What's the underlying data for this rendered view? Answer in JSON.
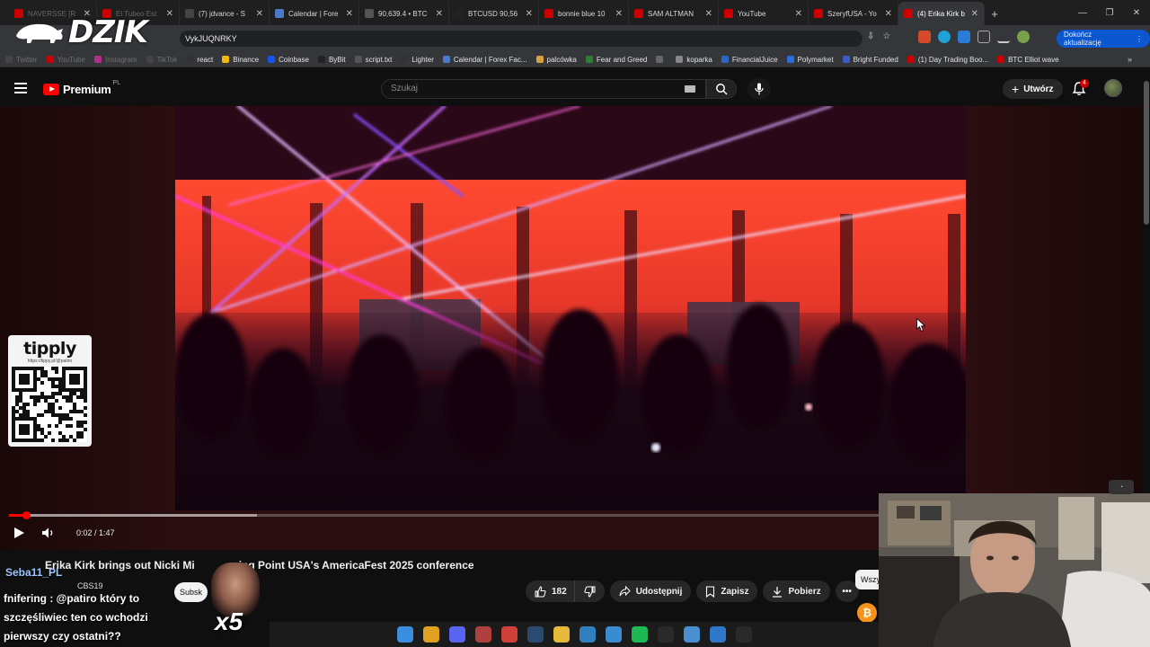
{
  "browser": {
    "tabs": [
      {
        "label": "NAVERSSE [R",
        "color": "#cc0000",
        "faded": true
      },
      {
        "label": "El Tubeo Est",
        "color": "#cc0000",
        "faded": true
      },
      {
        "label": "(7) jdvance - S",
        "color": "#444444"
      },
      {
        "label": "Calendar | Fore",
        "color": "#4a7ac8"
      },
      {
        "label": "90,639.4 • BTC",
        "color": "#555555"
      },
      {
        "label": "BTCUSD 90,56",
        "color": "#222222"
      },
      {
        "label": "bonnie blue 10",
        "color": "#cc0000"
      },
      {
        "label": "SAM ALTMAN",
        "color": "#cc0000"
      },
      {
        "label": "YouTube",
        "color": "#cc0000"
      },
      {
        "label": "SzeryfUSA - Yo",
        "color": "#cc0000"
      },
      {
        "label": "(4) Erika Kirk b",
        "color": "#cc0000",
        "active": true
      }
    ],
    "new_tab": "+",
    "close_glyph": "✕",
    "window_controls": [
      "—",
      "❐",
      "✕"
    ],
    "url": "VykJUQNRKY",
    "update_button": "Dokończ aktualizację",
    "bookmarks": [
      {
        "label": "Twitter",
        "color": "#444444",
        "faded": true
      },
      {
        "label": "YouTube",
        "color": "#cc0000",
        "faded": true
      },
      {
        "label": "Instagram",
        "color": "#b0308a",
        "faded": true
      },
      {
        "label": "TikTok",
        "color": "#444444",
        "faded": true
      },
      {
        "label": "react",
        "color": "#333333"
      },
      {
        "label": "Binance",
        "color": "#f0b90b"
      },
      {
        "label": "Coinbase",
        "color": "#1652f0"
      },
      {
        "label": "ByBit",
        "color": "#222222"
      },
      {
        "label": "script.txt",
        "color": "#555555"
      },
      {
        "label": "Lighter",
        "color": "#333333"
      },
      {
        "label": "Calendar | Forex Fac...",
        "color": "#4a7ac8"
      },
      {
        "label": "palcówka",
        "color": "#d8a040"
      },
      {
        "label": "Fear and Greed",
        "color": "#2e7d32"
      },
      {
        "label": "",
        "color": "#666666"
      },
      {
        "label": "koparka",
        "color": "#888888"
      },
      {
        "label": "FinancialJuice",
        "color": "#2a66c8"
      },
      {
        "label": "Polymarket",
        "color": "#2d6cdf"
      },
      {
        "label": "Bright Funded",
        "color": "#3a5cc8"
      },
      {
        "label": "(1) Day Trading Boo...",
        "color": "#cc0000"
      },
      {
        "label": "BTC Elliot wave",
        "color": "#cc0000"
      }
    ],
    "bookmarks_more": "»"
  },
  "overlay": {
    "logo_text": "DZIK",
    "tipply_brand": "tipply",
    "tipply_url": "https://tippy.pl/@patiro",
    "chat_user": "Seba11_PL",
    "chat_message": "fnifering : @patiro który to szczęśliwiec ten co wchodzi pierwszy czy ostatni??",
    "alert_count": "x5",
    "cam_badge": "◔"
  },
  "youtube": {
    "brand": "Premium",
    "region": "PL",
    "search_placeholder": "Szukaj",
    "create_label": "Utwórz",
    "notification_count": "4",
    "video": {
      "time": "0:02 / 1:47",
      "played_fraction": 0.02,
      "loaded_fraction": 0.285,
      "title": "Erika Kirk brings out Nicki Minaj at Turning Point USA's AmericaFest 2025 conference",
      "title_visible": "Erika Kirk brings out Nicki Mi",
      "title_visible_tail": "ing Point USA's AmericaFest 2025 conference",
      "channel": "CBS19",
      "subscribe_label": "Subsk",
      "like_count": "182",
      "share_label": "Udostępnij",
      "save_label": "Zapisz",
      "download_label": "Pobierz",
      "more_label": "•••",
      "all_label": "Wszy"
    }
  },
  "taskbar": {
    "apps": [
      {
        "name": "windows-start-icon",
        "color": "#3b8de0"
      },
      {
        "name": "chrome-icon",
        "color": "#e0a020"
      },
      {
        "name": "discord-icon",
        "color": "#5865f2"
      },
      {
        "name": "app-icon",
        "color": "#b04040"
      },
      {
        "name": "spotlight-icon",
        "color": "#d0403a"
      },
      {
        "name": "steam-icon",
        "color": "#2a4a70"
      },
      {
        "name": "file-explorer-icon",
        "color": "#e8b83a"
      },
      {
        "name": "ccleaner-icon",
        "color": "#3080c0"
      },
      {
        "name": "network-icon",
        "color": "#3a8cd0"
      },
      {
        "name": "spotify-icon",
        "color": "#1db954"
      },
      {
        "name": "streamlabs-icon",
        "color": "#2a2a2a"
      },
      {
        "name": "notepad-icon",
        "color": "#4a90d0"
      },
      {
        "name": "photos-icon",
        "color": "#2f78c8"
      },
      {
        "name": "terminal-icon",
        "color": "#2a2a2a"
      }
    ]
  }
}
